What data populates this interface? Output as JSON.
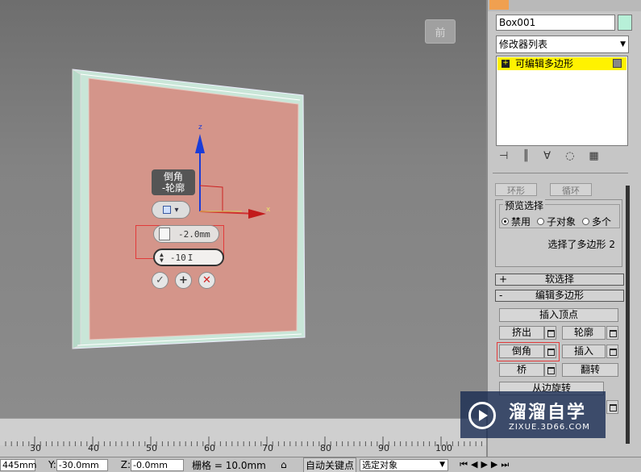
{
  "viewport": {
    "viewcube_label": "前",
    "caddy": {
      "label": "倒角\n-轮廓",
      "field_height": "-2.0mm",
      "field_outline": "-10"
    }
  },
  "panel": {
    "object_name": "Box001",
    "modifier_list": "修改器列表",
    "stack_item": "可编辑多边形",
    "cut_row": [
      "环形",
      "循环"
    ],
    "preview": {
      "title": "预览选择",
      "options": [
        "禁用",
        "子对象",
        "多个"
      ],
      "selected": "禁用",
      "selection_info": "选择了多边形 2"
    },
    "rollouts": {
      "soft_select": "软选择",
      "edit_poly": "编辑多边形"
    },
    "buttons": {
      "insert_vertex": "插入顶点",
      "extrude": "挤出",
      "outline": "轮廓",
      "bevel": "倒角",
      "inset": "插入",
      "bridge": "桥",
      "flip": "翻转",
      "hinge": "从边旋转"
    }
  },
  "timeline": {
    "ticks": [
      "30",
      "40",
      "50",
      "60",
      "70",
      "80",
      "90",
      "100"
    ]
  },
  "status": {
    "x_value": "445mm",
    "y_label": "Y:",
    "y_value": "-30.0mm",
    "z_label": "Z:",
    "z_value": "-0.0mm",
    "grid": "栅格 = 10.0mm",
    "auto_key": "自动关键点",
    "selection_set": "选定对象"
  },
  "watermark": {
    "title": "溜溜自学",
    "url": "ZIXUE.3D66.COM"
  },
  "colors": {
    "face_fill": "#d4958a",
    "edge_frame": "#c9e6d8",
    "stack_highlight": "#fff200",
    "selection_red": "#e23a3a",
    "watermark_bg": "#1c3566"
  }
}
